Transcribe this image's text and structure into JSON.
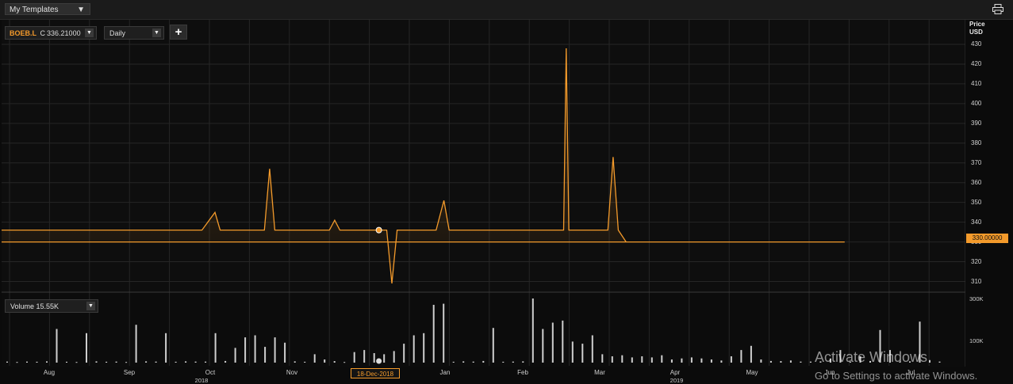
{
  "toolbar": {
    "templates_label": "My Templates",
    "templates_arrow": "▼",
    "print_icon": "printer-icon"
  },
  "instrument": {
    "symbol": "BOEB.L",
    "close_label": "C",
    "close_value": "336.21000",
    "dd": "▼"
  },
  "period": {
    "label": "Daily",
    "dd": "▼"
  },
  "add_button": "+",
  "volume_panel": {
    "label": "Volume 15.55K",
    "dd": "▼"
  },
  "price_axis": {
    "title": "Price",
    "unit": "USD",
    "last_price": "330.00000"
  },
  "crosshair_date": "18-Dec-2018",
  "watermark": {
    "line1": "Activate Windows",
    "line2": "Go to Settings to activate Windows."
  },
  "colors": {
    "accent": "#f39a2b",
    "background": "#0b0b0b",
    "grid": "#262626",
    "volume_bar": "#cfcfcf"
  },
  "chart_data": [
    {
      "type": "line",
      "series": [
        {
          "values": [
            336,
            336,
            336,
            345,
            336,
            336,
            367,
            336,
            336,
            341,
            336,
            336,
            336,
            336,
            309,
            336,
            336,
            351,
            336,
            336,
            336,
            336,
            336,
            428,
            336,
            336,
            373,
            336,
            330,
            330,
            330,
            330,
            330,
            330,
            330,
            330,
            330,
            330,
            330,
            330,
            330
          ]
        }
      ],
      "x_dates": [
        "Jul 26",
        "Aug 20",
        "Oct 11",
        "Oct 16",
        "Oct 18",
        "Nov 4",
        "Nov 6",
        "Nov 8",
        "Nov 29",
        "Dec 1",
        "Dec 3",
        "Dec 18",
        "Dec 20",
        "Dec 21",
        "Dec 23",
        "Dec 25",
        "Jan 9",
        "Jan 12",
        "Jan 14",
        "Feb 3",
        "Feb 24",
        "Feb 25",
        "Feb 27",
        "Feb 28",
        "Mar 1",
        "Mar 16",
        "Mar 18",
        "Mar 20",
        "Mar 23",
        "Apr 1",
        "Apr 15",
        "May 1",
        "May 15",
        "Jun 1",
        "Jun 15",
        "Jul 1",
        "Jul 10",
        "Jul 15",
        "Jul 20",
        "Jul 22",
        "Jul 25"
      ],
      "ylim": [
        305,
        432
      ],
      "y_ticks": [
        "310",
        "320",
        "330",
        "340",
        "350",
        "360",
        "370",
        "380",
        "390",
        "400",
        "410",
        "420",
        "430"
      ],
      "x_ticks": [
        "Aug",
        "Sep",
        "Oct",
        "Nov",
        "Dec",
        "Jan",
        "Feb",
        "Mar",
        "Apr",
        "May",
        "Jun",
        "Jul"
      ],
      "year_labels": [
        "2018",
        "2019"
      ],
      "highlight_point": {
        "x": "18-Dec-2018",
        "y": 336
      }
    },
    {
      "type": "bar",
      "x_ticks_values": [
        "300K",
        "100K"
      ],
      "ylim": [
        0,
        320000
      ],
      "values": [
        5000,
        3000,
        5000,
        4000,
        6000,
        160000,
        4000,
        3000,
        140000,
        6000,
        4000,
        5000,
        3000,
        180000,
        6000,
        5000,
        140000,
        4000,
        6000,
        5000,
        5000,
        140000,
        8000,
        70000,
        120000,
        130000,
        75000,
        120000,
        95000,
        6000,
        4000,
        40000,
        15000,
        7000,
        3000,
        50000,
        60000,
        45000,
        40000,
        55000,
        90000,
        130000,
        140000,
        275000,
        280000,
        4000,
        6000,
        5000,
        8000,
        165000,
        4000,
        5000,
        6000,
        305000,
        160000,
        190000,
        200000,
        100000,
        90000,
        130000,
        40000,
        30000,
        35000,
        25000,
        30000,
        25000,
        35000,
        15000,
        20000,
        25000,
        20000,
        15000,
        10000,
        30000,
        60000,
        80000,
        15000,
        8000,
        7000,
        10000,
        5000,
        5000,
        6000,
        20000,
        60000,
        5000,
        30000,
        8000,
        155000,
        60000,
        5000,
        6000,
        195000,
        12000,
        5000
      ]
    }
  ]
}
